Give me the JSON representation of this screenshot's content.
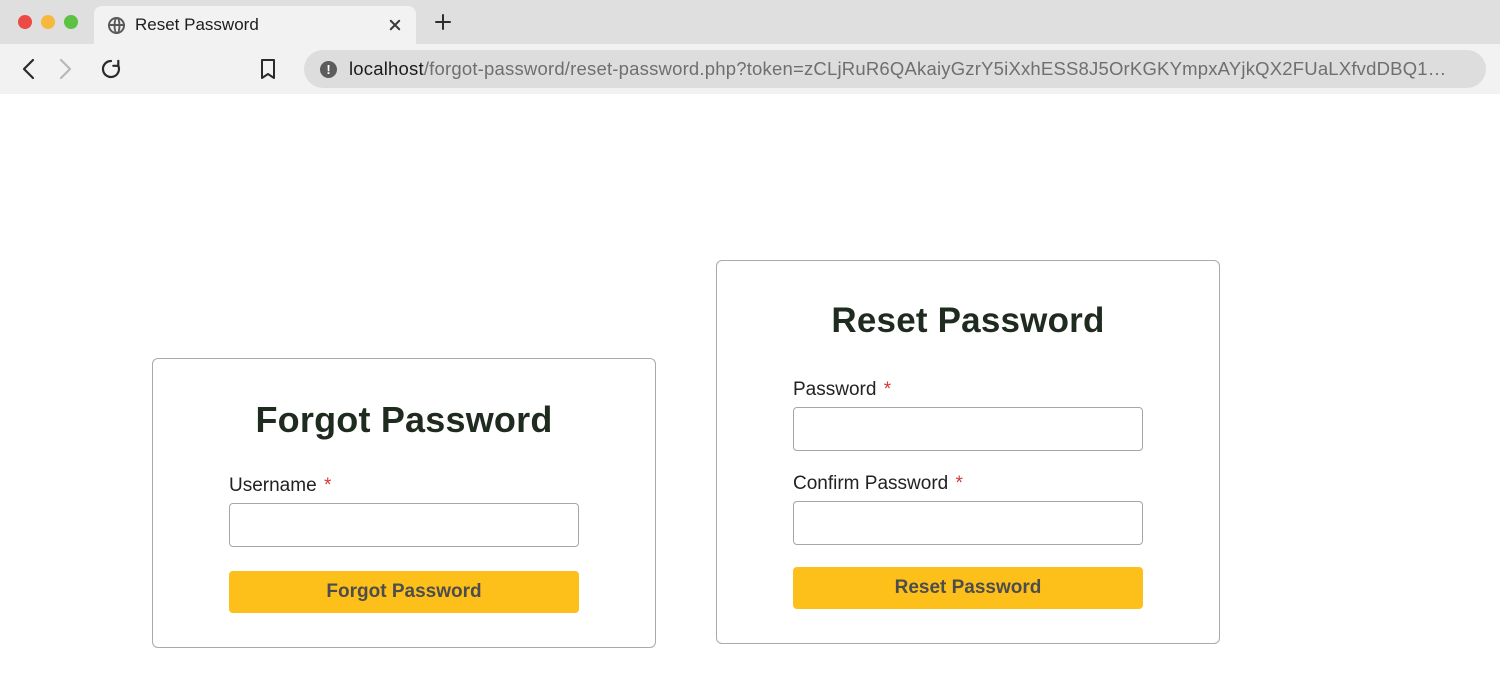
{
  "browser": {
    "tab_title": "Reset Password",
    "url_host": "localhost",
    "url_path": "/forgot-password/reset-password.php?token=zCLjRuR6QAkaiyGzrY5iXxhESS8J5OrKGKYmpxAYjkQX2FUaLXfvdDBQ1…"
  },
  "forgot_card": {
    "heading": "Forgot Password",
    "username_label": "Username",
    "required_mark": "*",
    "username_value": "",
    "submit_label": "Forgot Password"
  },
  "reset_card": {
    "heading": "Reset Password",
    "password_label": "Password",
    "confirm_label": "Confirm Password",
    "required_mark": "*",
    "password_value": "",
    "confirm_value": "",
    "submit_label": "Reset Password"
  }
}
